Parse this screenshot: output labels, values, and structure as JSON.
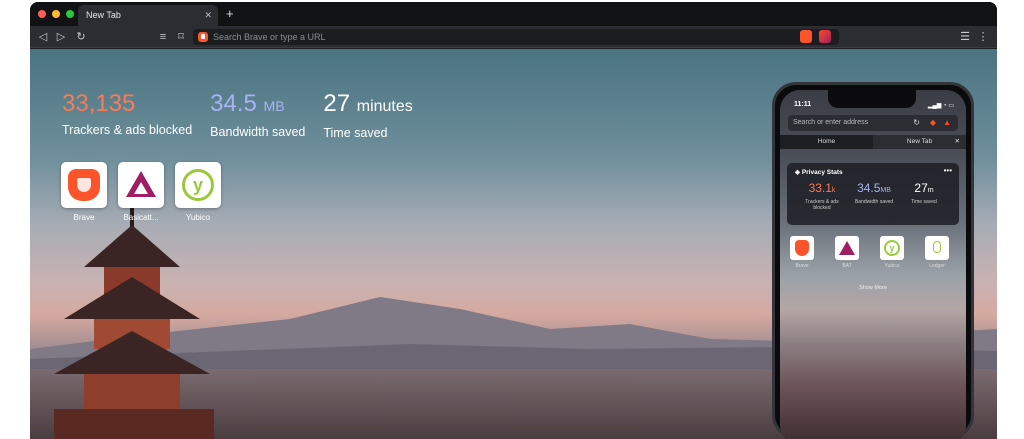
{
  "browser": {
    "traffic_lights": {
      "close": "#ff5f57",
      "minimize": "#febc2e",
      "zoom": "#28c840"
    },
    "tab": {
      "title": "New Tab",
      "close_icon": "close-icon"
    },
    "new_tab_icon": "+",
    "address_bar": {
      "placeholder": "Search Brave or type a URL"
    },
    "colors": {
      "accent": "#fb542b"
    }
  },
  "stats": [
    {
      "value": "33,135",
      "unit": "",
      "label": "Trackers & ads blocked",
      "color": "#fb7b54"
    },
    {
      "value": "34.5",
      "unit": "MB",
      "label": "Bandwidth saved",
      "color": "#a5b4f4"
    },
    {
      "value": "27",
      "unit": "minutes",
      "label": "Time saved",
      "color": "#ffffff"
    }
  ],
  "top_sites": [
    {
      "label": "Brave",
      "icon": "brave-lion-icon"
    },
    {
      "label": "Basicatt...",
      "icon": "bat-triangle-icon"
    },
    {
      "label": "Yubico",
      "icon": "yubico-icon"
    }
  ],
  "phone": {
    "time": "11:11",
    "address_placeholder": "Search or enter address",
    "tabs": [
      "Home",
      "New Tab"
    ],
    "card_title": "Privacy Stats",
    "stats": [
      {
        "value": "33.1",
        "unit": "k",
        "label": "Trackers & ads blocked",
        "color": "#fb7b54"
      },
      {
        "value": "34.5",
        "unit": "MB",
        "label": "Bandwidth saved",
        "color": "#a5b4f4"
      },
      {
        "value": "27",
        "unit": "m",
        "label": "Time saved",
        "color": "#ffffff"
      }
    ],
    "tiles": [
      "Brave",
      "BAT",
      "Yubico",
      "Ledger"
    ],
    "show_more": "Show More"
  }
}
